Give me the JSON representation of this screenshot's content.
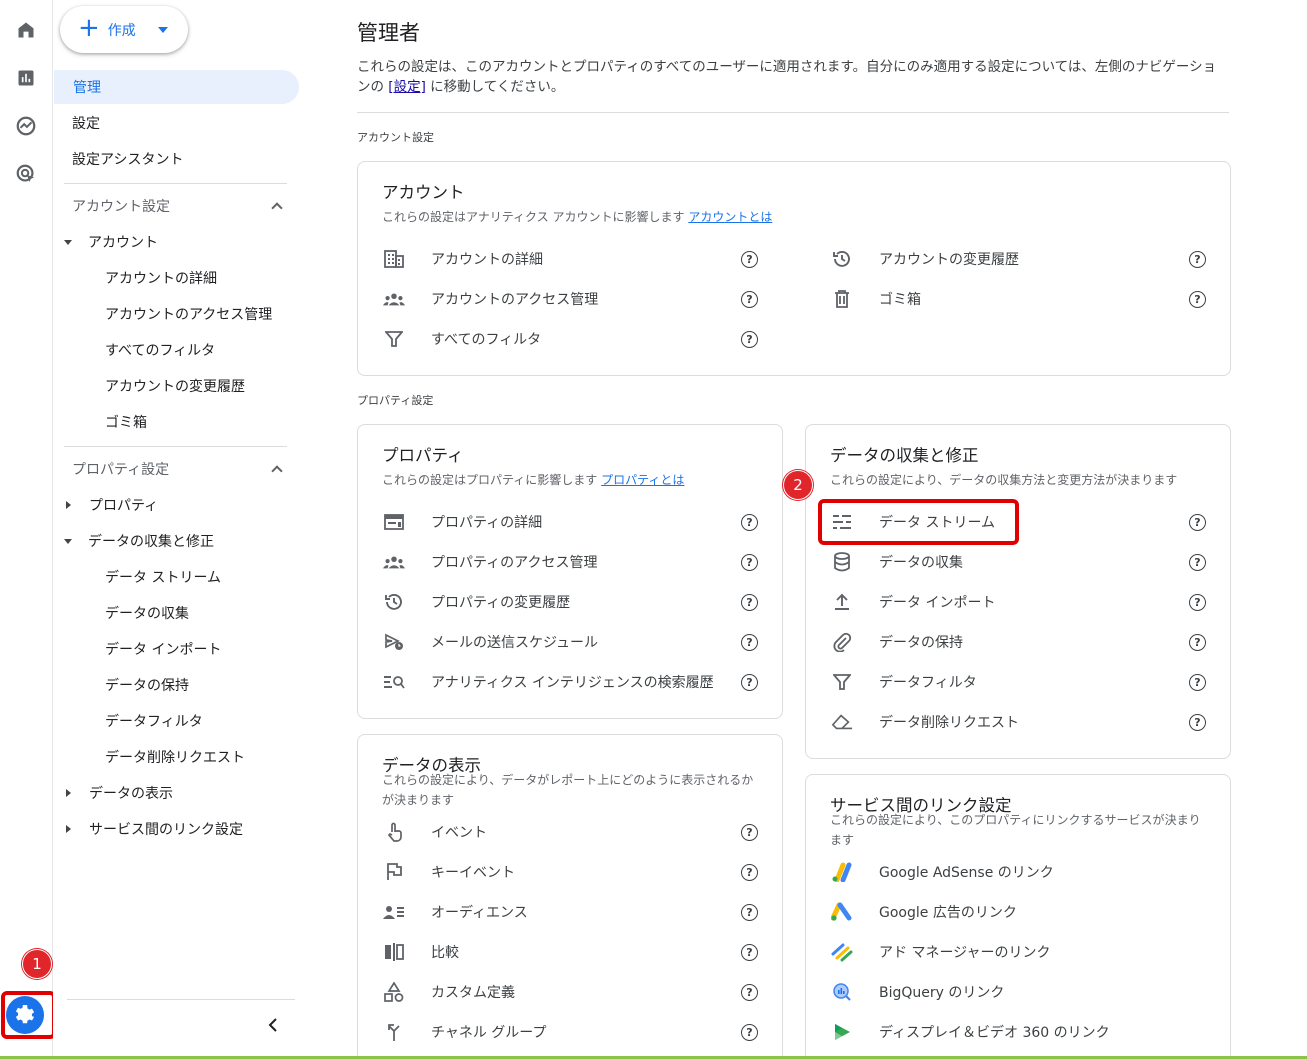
{
  "nav": {
    "create_label": "作成",
    "items": [
      {
        "label": "管理"
      },
      {
        "label": "設定"
      },
      {
        "label": "設定アシスタント"
      }
    ],
    "account_section": "アカウント設定",
    "account_tree": "アカウント",
    "account_sub": [
      "アカウントの詳細",
      "アカウントのアクセス管理",
      "すべてのフィルタ",
      "アカウントの変更履歴",
      "ゴミ箱"
    ],
    "property_section": "プロパティ設定",
    "property_tree": "プロパティ",
    "data_tree": "データの収集と修正",
    "data_sub": [
      "データ ストリーム",
      "データの収集",
      "データ インポート",
      "データの保持",
      "データフィルタ",
      "データ削除リクエスト"
    ],
    "display_tree": "データの表示",
    "link_tree": "サービス間のリンク設定"
  },
  "main": {
    "title": "管理者",
    "desc_before": "これらの設定は、このアカウントとプロパティのすべてのユーザーに適用されます。自分にのみ適用する設定については、左側のナビゲーションの ",
    "desc_link": "[設定]",
    "desc_after": " に移動してください。",
    "account_group": "アカウント設定",
    "property_group": "プロパティ設定"
  },
  "account_card": {
    "title": "アカウント",
    "sub": "これらの設定はアナリティクス アカウントに影響します ",
    "sub_link": "アカウントとは",
    "left": [
      "アカウントの詳細",
      "アカウントのアクセス管理",
      "すべてのフィルタ"
    ],
    "right": [
      "アカウントの変更履歴",
      "ゴミ箱"
    ]
  },
  "property_card": {
    "title": "プロパティ",
    "sub": "これらの設定はプロパティに影響します ",
    "sub_link": "プロパティとは",
    "rows": [
      "プロパティの詳細",
      "プロパティのアクセス管理",
      "プロパティの変更履歴",
      "メールの送信スケジュール",
      "アナリティクス インテリジェンスの検索履歴"
    ]
  },
  "data_card": {
    "title": "データの収集と修正",
    "sub": "これらの設定により、データの収集方法と変更方法が決まります",
    "rows": [
      "データ ストリーム",
      "データの収集",
      "データ インポート",
      "データの保持",
      "データフィルタ",
      "データ削除リクエスト"
    ]
  },
  "display_card": {
    "title": "データの表示",
    "sub": "これらの設定により、データがレポート上にどのように表示されるかが決まります",
    "rows": [
      "イベント",
      "キーイベント",
      "オーディエンス",
      "比較",
      "カスタム定義",
      "チャネル グループ"
    ]
  },
  "link_card": {
    "title": "サービス間のリンク設定",
    "sub": "これらの設定により、このプロパティにリンクするサービスが決まります",
    "rows": [
      "Google AdSense のリンク",
      "Google 広告のリンク",
      "アド マネージャーのリンク",
      "BigQuery のリンク",
      "ディスプレイ＆ビデオ 360 のリンク"
    ]
  },
  "annotations": {
    "badge1": "1",
    "badge2": "2"
  },
  "help_glyph": "?",
  "colors": {
    "accent": "#1a73e8",
    "annotation_red": "#e00000"
  }
}
